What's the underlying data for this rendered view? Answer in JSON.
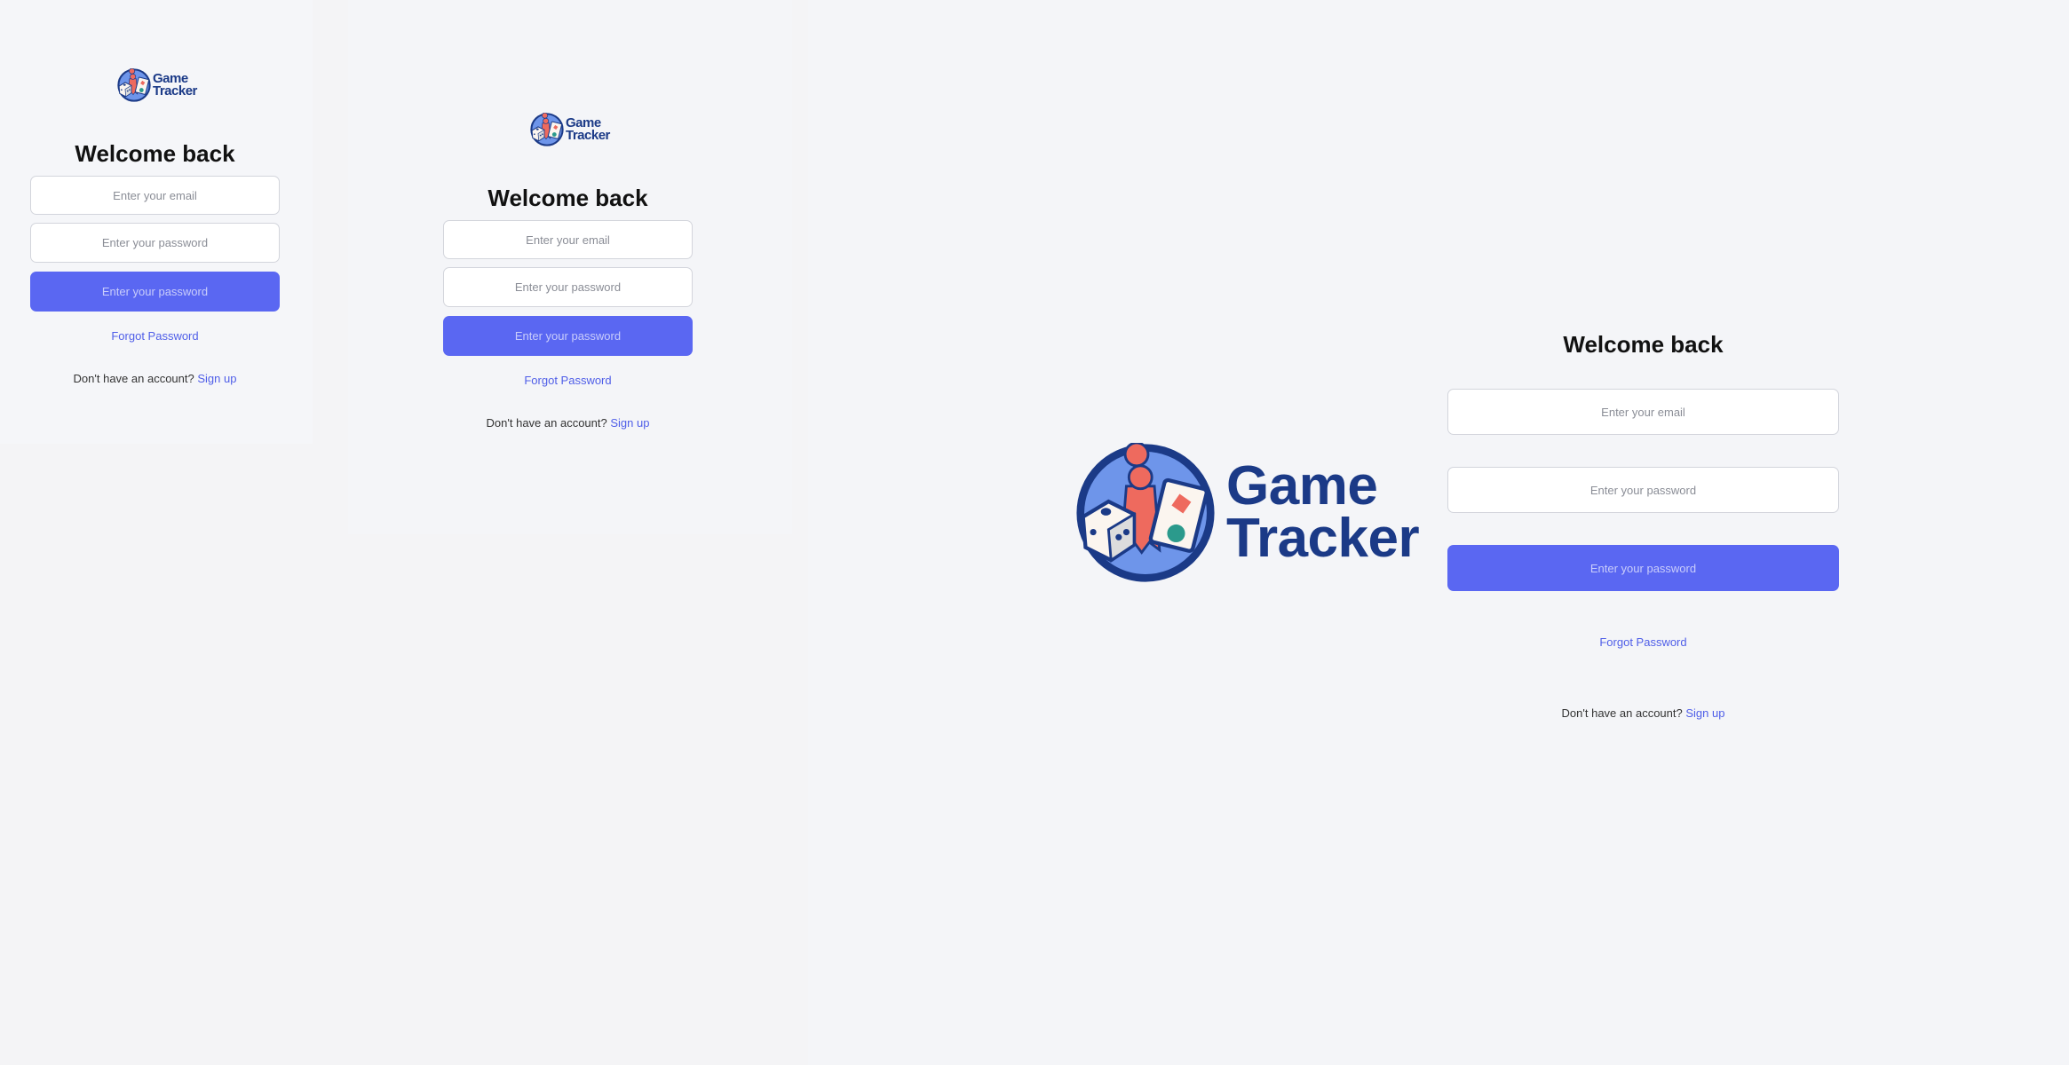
{
  "logo": {
    "line1": "Game",
    "line2": "Tracker"
  },
  "login": {
    "title": "Welcome back",
    "email_placeholder": "Enter your email",
    "password_placeholder": "Enter your password",
    "submit_label": "Enter your password",
    "forgot_label": "Forgot Password",
    "signup_prompt": "Don't have an account?",
    "signup_link": "Sign up"
  },
  "colors": {
    "accent": "#5a67f2",
    "link": "#4f5ee8",
    "brand": "#1b3a87"
  }
}
